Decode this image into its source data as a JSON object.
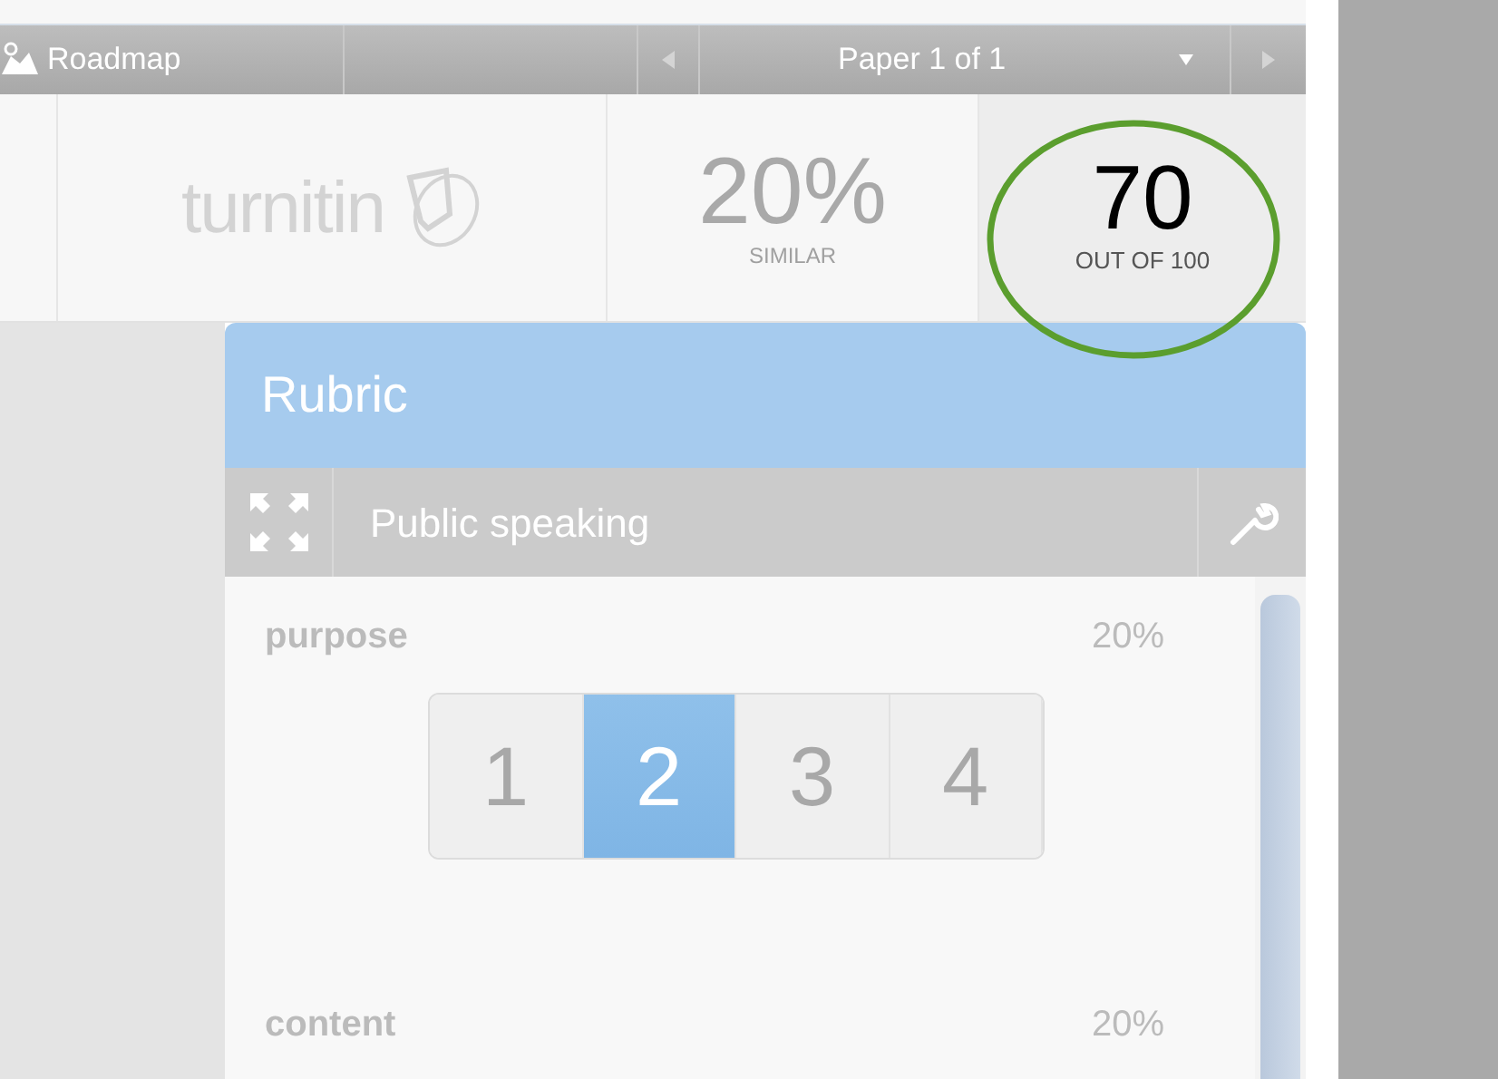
{
  "toolbar": {
    "roadmap": "Roadmap",
    "paper": "Paper 1 of 1"
  },
  "scores": {
    "logo": "turnitin",
    "similarity": "20%",
    "similarity_label": "SIMILAR",
    "grade": "70",
    "grade_label": "OUT OF 100",
    "grade_circled": true
  },
  "rubric": {
    "title": "Rubric",
    "name": "Public speaking",
    "criteria": [
      {
        "name": "purpose",
        "weight": "20%",
        "scale": [
          {
            "label": "1",
            "selected": false
          },
          {
            "label": "2",
            "selected": true
          },
          {
            "label": "3",
            "selected": false
          },
          {
            "label": "4",
            "selected": false
          }
        ]
      },
      {
        "name": "content",
        "weight": "20%"
      }
    ]
  }
}
